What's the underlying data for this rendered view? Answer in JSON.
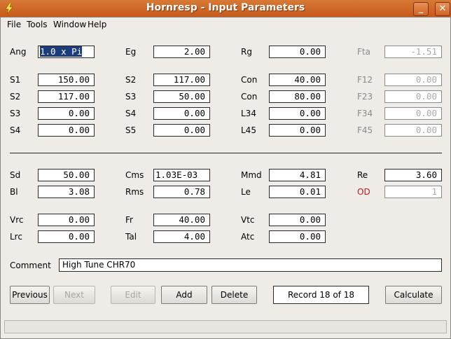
{
  "window": {
    "title": "Hornresp - Input Parameters",
    "controls": [
      "_",
      "□",
      "✕"
    ]
  },
  "menu": [
    "File",
    "Tools",
    "Window",
    "Help"
  ],
  "params": {
    "Ang": {
      "label": "Ang",
      "value": "1.0 x Pi"
    },
    "Eg": {
      "label": "Eg",
      "value": "2.00"
    },
    "Rg": {
      "label": "Rg",
      "value": "0.00"
    },
    "Fta": {
      "label": "Fta",
      "value": "-1.51"
    },
    "S1": {
      "label": "S1",
      "value": "150.00"
    },
    "S2a": {
      "label": "S2",
      "value": "117.00"
    },
    "Con1": {
      "label": "Con",
      "value": "40.00"
    },
    "F12": {
      "label": "F12",
      "value": "0.00"
    },
    "S2": {
      "label": "S2",
      "value": "117.00"
    },
    "S3a": {
      "label": "S3",
      "value": "50.00"
    },
    "Con2": {
      "label": "Con",
      "value": "80.00"
    },
    "F23": {
      "label": "F23",
      "value": "0.00"
    },
    "S3": {
      "label": "S3",
      "value": "0.00"
    },
    "S4a": {
      "label": "S4",
      "value": "0.00"
    },
    "L34": {
      "label": "L34",
      "value": "0.00"
    },
    "F34": {
      "label": "F34",
      "value": "0.00"
    },
    "S4": {
      "label": "S4",
      "value": "0.00"
    },
    "S5": {
      "label": "S5",
      "value": "0.00"
    },
    "L45": {
      "label": "L45",
      "value": "0.00"
    },
    "F45": {
      "label": "F45",
      "value": "0.00"
    },
    "Sd": {
      "label": "Sd",
      "value": "50.00"
    },
    "Cms": {
      "label": "Cms",
      "value": "1.03E-03"
    },
    "Mmd": {
      "label": "Mmd",
      "value": "4.81"
    },
    "Re": {
      "label": "Re",
      "value": "3.60"
    },
    "Bl": {
      "label": "Bl",
      "value": "3.08"
    },
    "Rms": {
      "label": "Rms",
      "value": "0.78"
    },
    "Le": {
      "label": "Le",
      "value": "0.01"
    },
    "OD": {
      "label": "OD",
      "value": "1"
    },
    "Vrc": {
      "label": "Vrc",
      "value": "0.00"
    },
    "Fr": {
      "label": "Fr",
      "value": "40.00"
    },
    "Vtc": {
      "label": "Vtc",
      "value": "0.00"
    },
    "Lrc": {
      "label": "Lrc",
      "value": "0.00"
    },
    "Tal": {
      "label": "Tal",
      "value": "4.00"
    },
    "Atc": {
      "label": "Atc",
      "value": "0.00"
    }
  },
  "comment": {
    "label": "Comment",
    "value": "High Tune CHR70"
  },
  "buttons": {
    "previous": "Previous",
    "next": "Next",
    "edit": "Edit",
    "add": "Add",
    "delete": "Delete",
    "calculate": "Calculate"
  },
  "record": "Record 18 of 18",
  "colors": {
    "titlebar": "#c7581a",
    "od_label": "#e01010",
    "selection": "#1d3d7a"
  },
  "icons": {
    "app": "lightning-icon"
  }
}
